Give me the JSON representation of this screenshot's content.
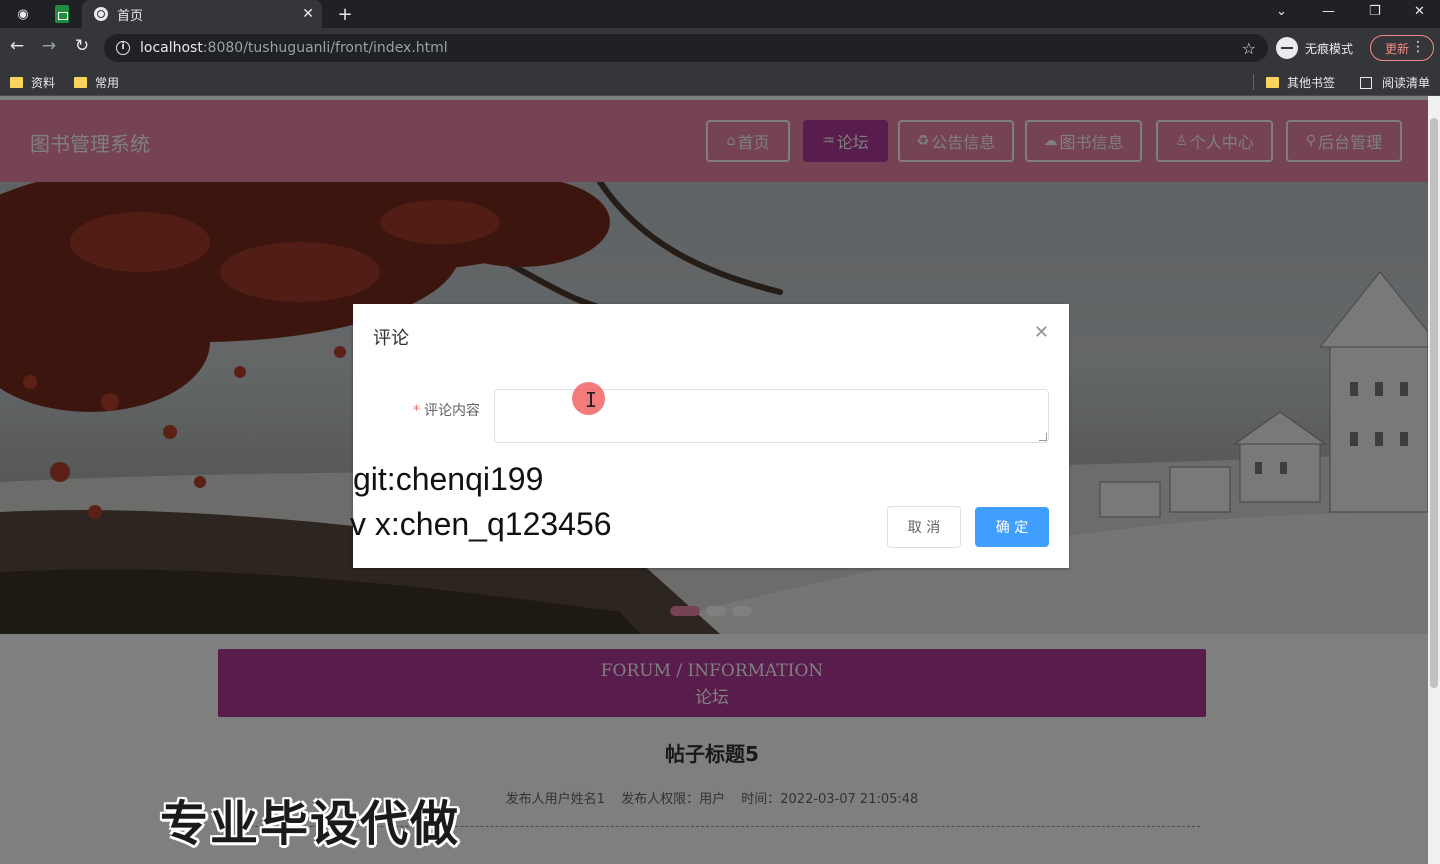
{
  "browser": {
    "tab_title": "首页",
    "new_tab": "+",
    "url_host": "localhost",
    "url_rest": ":8080/tushuguanli/front/index.html",
    "incognito_label": "无痕模式",
    "update_label": "更新",
    "bookmarks": [
      {
        "label": "资料"
      },
      {
        "label": "常用"
      }
    ],
    "other_bookmarks": "其他书签",
    "reading_list": "阅读清单"
  },
  "site": {
    "logo": "图书管理系统",
    "nav": [
      {
        "label": "首页",
        "icon": "home-icon",
        "glyph": "⌂",
        "active": false
      },
      {
        "label": "论坛",
        "icon": "forum-icon",
        "glyph": "♒",
        "active": true
      },
      {
        "label": "公告信息",
        "icon": "recycle-icon",
        "glyph": "♻",
        "active": false
      },
      {
        "label": "图书信息",
        "icon": "cloud-icon",
        "glyph": "☁",
        "active": false
      },
      {
        "label": "个人中心",
        "icon": "user-icon",
        "glyph": "♙",
        "active": false
      },
      {
        "label": "后台管理",
        "icon": "link-icon",
        "glyph": "⚲",
        "active": false
      }
    ],
    "colors": {
      "header": "#ea86a6",
      "accent": "#b0389a",
      "primary": "#409eff"
    }
  },
  "section": {
    "title_en": "FORUM / INFORMATION",
    "title_zh": "论坛"
  },
  "post": {
    "title": "帖子标题5",
    "author": "发布人用户姓名1",
    "role": "发布人权限：用户",
    "time": "时间：2022-03-07 21:05:48"
  },
  "dialog": {
    "title": "评论",
    "field_label": "评论内容",
    "field_value": "",
    "cancel_label": "取 消",
    "ok_label": "确 定"
  },
  "overlay": {
    "git": "git:chenqi199",
    "vx": "v x:chen_q123456",
    "ad": "专业毕设代做"
  }
}
